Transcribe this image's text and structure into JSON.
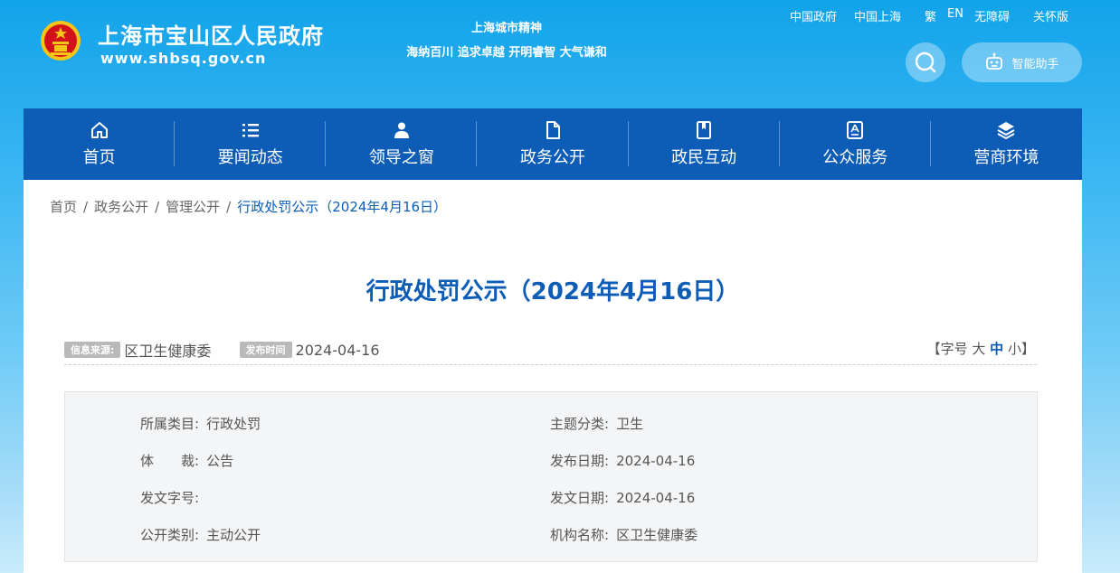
{
  "header": {
    "site_title": "上海市宝山区人民政府",
    "site_url": "www.shbsq.gov.cn",
    "spirit_title": "上海城市精神",
    "spirit_text": "海纳百川 追求卓越 开明睿智 大气谦和",
    "top_links": [
      "中国政府",
      "中国上海",
      "繁",
      "EN",
      "无障碍",
      "关怀版"
    ],
    "assistant_label": "智能助手"
  },
  "nav": {
    "items": [
      {
        "label": "首页",
        "icon": "home-icon"
      },
      {
        "label": "要闻动态",
        "icon": "list-icon"
      },
      {
        "label": "领导之窗",
        "icon": "person-icon"
      },
      {
        "label": "政务公开",
        "icon": "document-icon"
      },
      {
        "label": "政民互动",
        "icon": "bookmark-icon"
      },
      {
        "label": "公众服务",
        "icon": "service-icon"
      },
      {
        "label": "营商环境",
        "icon": "layers-icon"
      }
    ]
  },
  "breadcrumb": {
    "items": [
      "首页",
      "政务公开",
      "管理公开"
    ],
    "current": "行政处罚公示（2024年4月16日）",
    "separator": "/"
  },
  "article": {
    "title": "行政处罚公示（2024年4月16日）",
    "source_tag": "信息来源:",
    "source": "区卫生健康委",
    "date_tag": "发布时间",
    "date": "2024-04-16",
    "font_size": {
      "prefix": "【字号",
      "large": "大",
      "medium": "中",
      "small": "小",
      "suffix": "】"
    }
  },
  "info": {
    "category_label": "所属类目:",
    "category": "行政处罚",
    "topic_label": "主题分类:",
    "topic": "卫生",
    "genre_label": "体　　裁:",
    "genre": "公告",
    "pubdate_label": "发布日期:",
    "pubdate": "2024-04-16",
    "docno_label": "发文字号:",
    "docno": "",
    "docdate_label": "发文日期:",
    "docdate": "2024-04-16",
    "opentype_label": "公开类别:",
    "opentype": "主动公开",
    "org_label": "机构名称:",
    "org": "区卫生健康委"
  },
  "colors": {
    "primary": "#0d5cb6",
    "header_bg": "#12a3ea",
    "emblem_red": "#d2121b",
    "emblem_gold": "#f5c518"
  }
}
